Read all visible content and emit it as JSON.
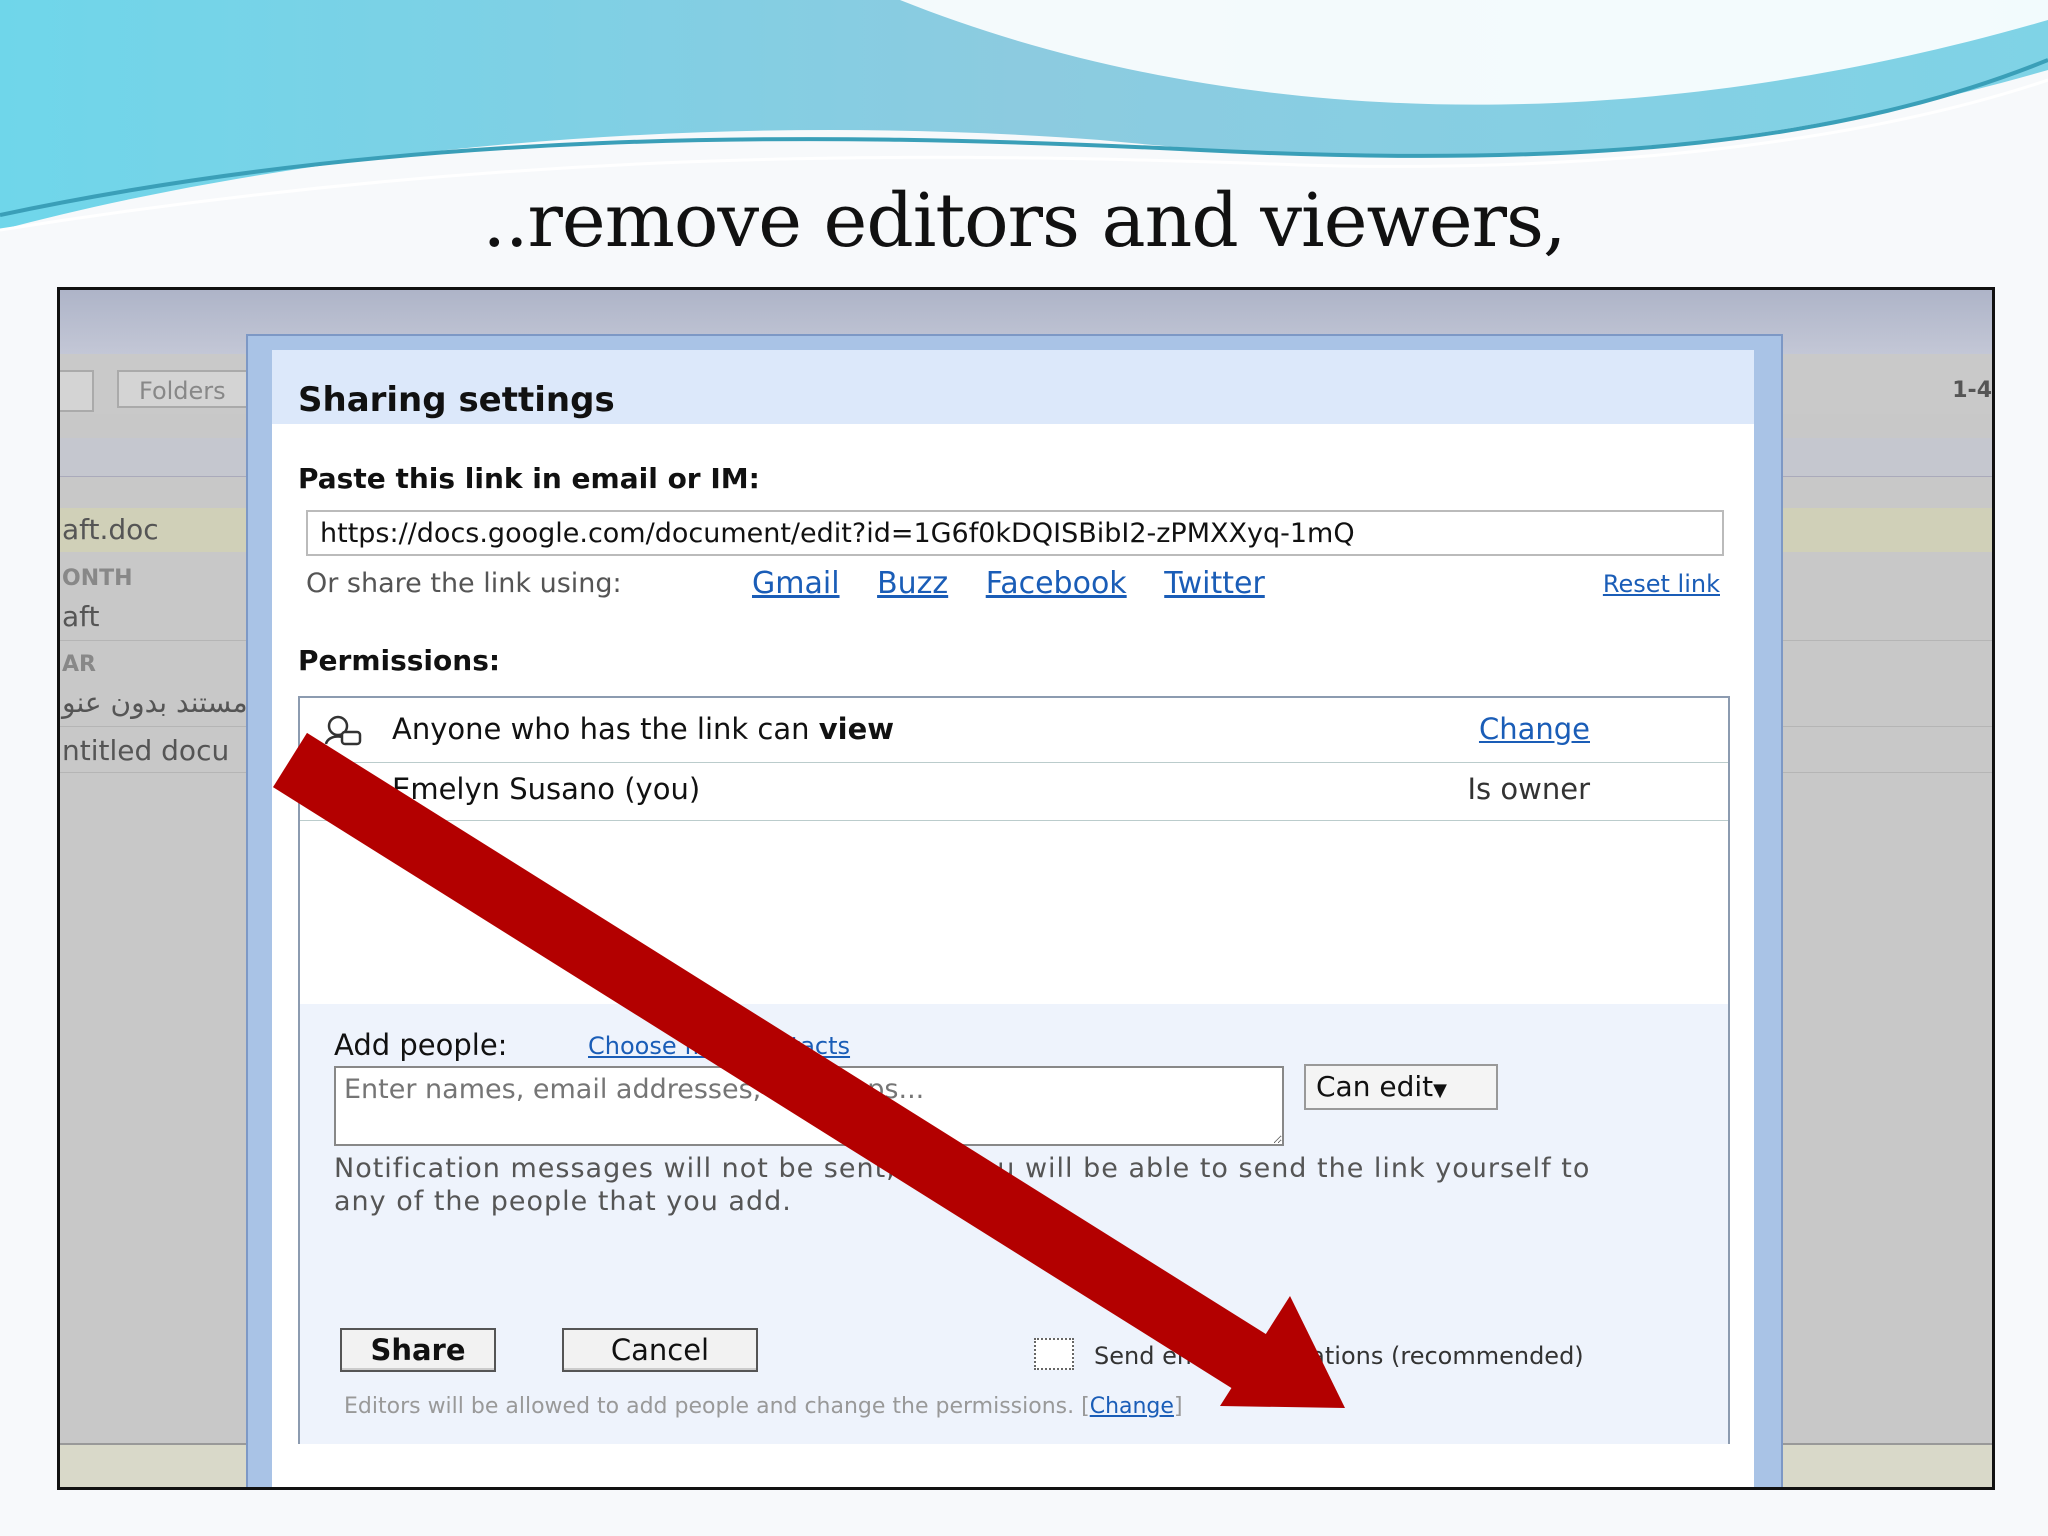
{
  "slide": {
    "title": "..remove editors and viewers,"
  },
  "app": {
    "folders_label": "Folders",
    "page_count": "1-4",
    "docs": [
      {
        "label": "aft.doc"
      },
      {
        "label": "ONTH"
      },
      {
        "label": "aft"
      },
      {
        "label": "AR"
      },
      {
        "label": "مستند بدون عنو"
      },
      {
        "label": "ntitled docu"
      }
    ]
  },
  "dialog": {
    "title": "Sharing settings",
    "paste_label": "Paste this link in email or IM:",
    "link_value": "https://docs.google.com/document/edit?id=1G6f0kDQISBibI2-zPMXXyq-1mQ",
    "share_using_label": "Or share the link using:",
    "share_links": [
      "Gmail",
      "Buzz",
      "Facebook",
      "Twitter"
    ],
    "reset_link": "Reset link",
    "permissions_label": "Permissions:",
    "permissions": [
      {
        "text": "Anyone who has the link can ",
        "bold": "view",
        "right": "Change",
        "icon": "people-link-icon"
      },
      {
        "text": "Emelyn Susano (you)",
        "bold": "",
        "right": "Is owner",
        "icon": "avatar"
      }
    ],
    "add_people_label": "Add people:",
    "choose_contacts": "Choose from contacts",
    "names_placeholder": "Enter names, email addresses, or groups...",
    "role_select": "Can edit",
    "note": "Notification messages will not be sent, but you will be able to send the link yourself to any of the people that you add.",
    "share_button": "Share",
    "cancel_button": "Cancel",
    "notify_label": "Send email notifications (recommended)",
    "editors_note": "Editors will be allowed to add people and change the permissions.",
    "editors_change": "Change"
  },
  "colors": {
    "arrow": "#b30000",
    "link": "#1a5db7",
    "dialog_border": "#a9c3e6"
  }
}
